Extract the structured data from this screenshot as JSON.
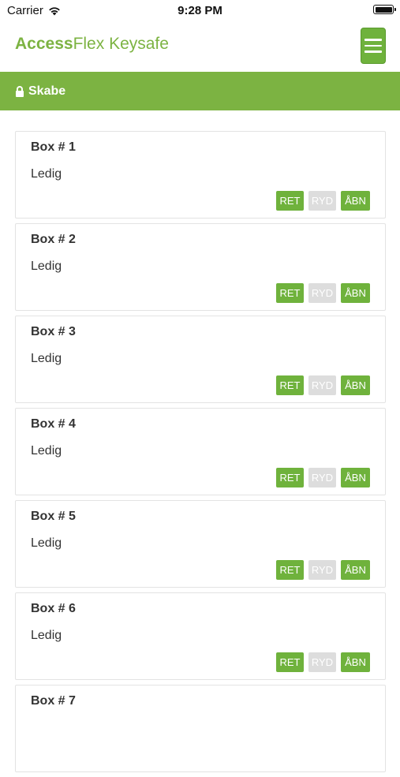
{
  "status_bar": {
    "carrier": "Carrier",
    "time": "9:28 PM",
    "wifi_icon": "wifi-icon",
    "battery_icon": "battery-icon"
  },
  "header": {
    "title_bold": "Access",
    "title_rest": "Flex Keysafe",
    "menu_icon": "hamburger-icon"
  },
  "section": {
    "icon": "lock-icon",
    "title": "Skabe"
  },
  "colors": {
    "accent": "#7cb342",
    "button_active": "#6fb23c",
    "button_disabled": "#dddddd"
  },
  "boxes": [
    {
      "title": "Box # 1",
      "status": "Ledig",
      "btn_ret": "RET",
      "btn_ryd": "RYD",
      "btn_abn": "ÅBN"
    },
    {
      "title": "Box # 2",
      "status": "Ledig",
      "btn_ret": "RET",
      "btn_ryd": "RYD",
      "btn_abn": "ÅBN"
    },
    {
      "title": "Box # 3",
      "status": "Ledig",
      "btn_ret": "RET",
      "btn_ryd": "RYD",
      "btn_abn": "ÅBN"
    },
    {
      "title": "Box # 4",
      "status": "Ledig",
      "btn_ret": "RET",
      "btn_ryd": "RYD",
      "btn_abn": "ÅBN"
    },
    {
      "title": "Box # 5",
      "status": "Ledig",
      "btn_ret": "RET",
      "btn_ryd": "RYD",
      "btn_abn": "ÅBN"
    },
    {
      "title": "Box # 6",
      "status": "Ledig",
      "btn_ret": "RET",
      "btn_ryd": "RYD",
      "btn_abn": "ÅBN"
    },
    {
      "title": "Box # 7",
      "status": "",
      "btn_ret": "",
      "btn_ryd": "",
      "btn_abn": ""
    }
  ]
}
